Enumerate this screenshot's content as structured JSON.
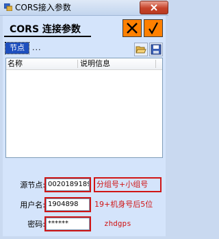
{
  "window": {
    "title": "CORS接入参数"
  },
  "header": {
    "title": "CORS 连接参数",
    "close_label": "✕",
    "confirm_label": "√"
  },
  "tabs": [
    {
      "label": "节点"
    }
  ],
  "tab_overflow": "...",
  "toolbar": {
    "open_icon": "folder-open-icon",
    "save_icon": "floppy-disk-icon"
  },
  "list": {
    "columns": [
      "名称",
      "说明信息"
    ],
    "rows": []
  },
  "form": {
    "source_node": {
      "label": "源节点:",
      "value": "0020189189",
      "hint": "分组号+小组号"
    },
    "username": {
      "label": "用户名:",
      "value": "1904898",
      "hint": "19+机身号后5位"
    },
    "password": {
      "label": "密码:",
      "value": "******",
      "hint": "zhdgps"
    }
  },
  "colors": {
    "accent": "#ff8000",
    "highlight": "#d01515",
    "tab": "#1e4fbe",
    "background": "#d4e4fb"
  }
}
